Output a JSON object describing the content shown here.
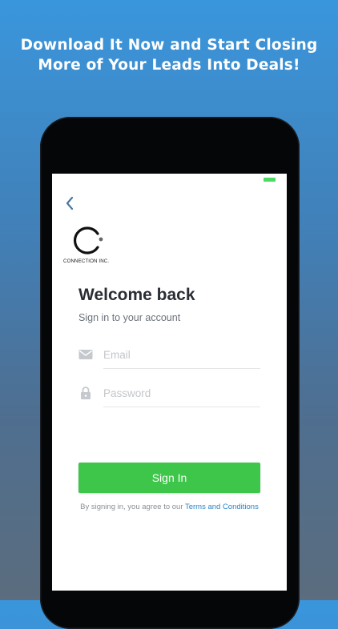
{
  "promo": {
    "line1": "Download It Now and Start Closing",
    "line2": "More of Your Leads Into Deals!"
  },
  "status_bar": {
    "battery_icon": "battery-icon",
    "battery_color": "#4cd964"
  },
  "nav": {
    "back_icon": "chevron-left-icon"
  },
  "brand": {
    "logo_text": "CONNECTION INC.",
    "logo_icon": "c-ring-logo"
  },
  "login": {
    "title": "Welcome back",
    "subtitle": "Sign in to your account",
    "email": {
      "placeholder": "Email",
      "value": "",
      "icon": "envelope-icon"
    },
    "password": {
      "placeholder": "Password",
      "value": "",
      "icon": "lock-icon"
    },
    "submit_label": "Sign In",
    "terms_prefix": "By signing in, you agree to our ",
    "terms_link": "Terms and Conditions"
  },
  "colors": {
    "accent_green": "#3ec64a",
    "link_blue": "#2a85c8",
    "background_top": "#3a96dc",
    "background_bottom": "#5b6d7e"
  }
}
